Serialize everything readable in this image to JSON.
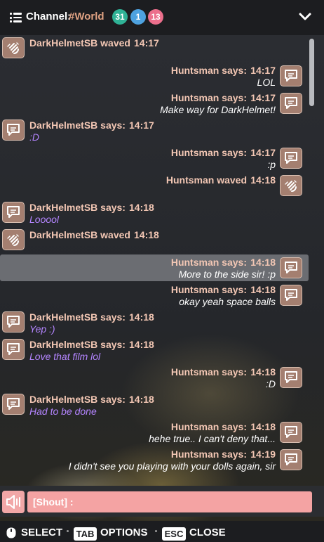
{
  "header": {
    "label": "Channel:",
    "channel": "#World",
    "badges": [
      {
        "value": "31",
        "color": "#2fb296"
      },
      {
        "value": "1",
        "color": "#4ea2e0"
      },
      {
        "value": "13",
        "color": "#ec6f8c"
      }
    ]
  },
  "messages": [
    {
      "side": "left",
      "icon": "wave-icon",
      "name": "DarkHelmetSB waved",
      "time": "14:17",
      "text": ""
    },
    {
      "side": "right",
      "icon": "chat-icon",
      "name": "Huntsman says:",
      "time": "14:17",
      "text": "LOL",
      "tone": "w"
    },
    {
      "side": "right",
      "icon": "chat-icon",
      "name": "Huntsman says:",
      "time": "14:17",
      "text": "Make way for DarkHelmet!",
      "tone": "w"
    },
    {
      "side": "left",
      "icon": "chat-icon",
      "name": "DarkHelmetSB says:",
      "time": "14:17",
      "text": ":D",
      "tone": "p"
    },
    {
      "side": "right",
      "icon": "chat-icon",
      "name": "Huntsman says:",
      "time": "14:17",
      "text": ":p",
      "tone": "w"
    },
    {
      "side": "right",
      "icon": "wave-icon",
      "name": "Huntsman waved",
      "time": "14:18",
      "text": ""
    },
    {
      "side": "left",
      "icon": "chat-icon",
      "name": "DarkHelmetSB says:",
      "time": "14:18",
      "text": "Looool",
      "tone": "p"
    },
    {
      "side": "left",
      "icon": "wave-icon",
      "name": "DarkHelmetSB waved",
      "time": "14:18",
      "text": ""
    },
    {
      "side": "right",
      "icon": "chat-icon",
      "name": "Huntsman says:",
      "time": "14:18",
      "text": "More to the side sir! :p",
      "tone": "w",
      "highlight": true
    },
    {
      "side": "right",
      "icon": "chat-icon",
      "name": "Huntsman says:",
      "time": "14:18",
      "text": "okay yeah space balls",
      "tone": "w"
    },
    {
      "side": "left",
      "icon": "chat-icon",
      "name": "DarkHelmetSB says:",
      "time": "14:18",
      "text": "Yep :)",
      "tone": "p"
    },
    {
      "side": "left",
      "icon": "chat-icon",
      "name": "DarkHelmetSB says:",
      "time": "14:18",
      "text": "Love that film lol",
      "tone": "p"
    },
    {
      "side": "right",
      "icon": "chat-icon",
      "name": "Huntsman says:",
      "time": "14:18",
      "text": ":D",
      "tone": "w"
    },
    {
      "side": "left",
      "icon": "chat-icon",
      "name": "DarkHelmetSB says:",
      "time": "14:18",
      "text": "Had to be done",
      "tone": "p"
    },
    {
      "side": "right",
      "icon": "chat-icon",
      "name": "Huntsman says:",
      "time": "14:18",
      "text": "hehe true.. I can't deny that...",
      "tone": "w"
    },
    {
      "side": "right",
      "icon": "chat-icon",
      "name": "Huntsman says:",
      "time": "14:19",
      "text": "I didn't see you playing with your dolls again, sir",
      "tone": "w"
    }
  ],
  "input": {
    "value": "[Shout] :"
  },
  "footer": {
    "select_key": "",
    "select_label": "SELECT",
    "options_key": "TAB",
    "options_label": "OPTIONS",
    "close_key": "ESC",
    "close_label": "CLOSE"
  }
}
